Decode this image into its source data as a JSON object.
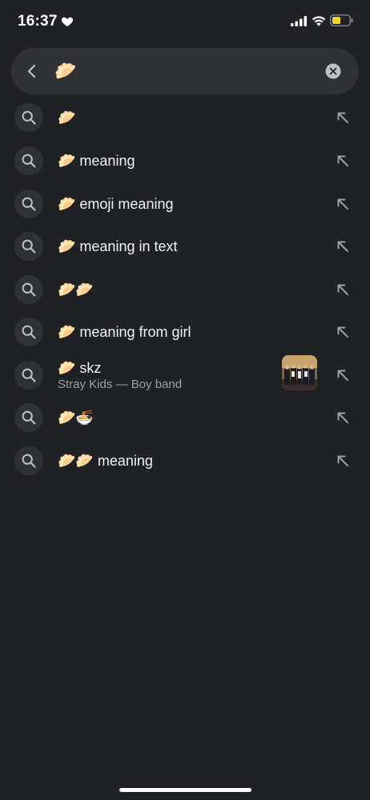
{
  "status_bar": {
    "time": "16:37",
    "heart_icon": "heart-icon",
    "signal_icon": "cellular-signal-icon",
    "wifi_icon": "wifi-icon",
    "battery_icon": "battery-icon",
    "battery_color": "#f2d230",
    "battery_percent": 50
  },
  "search": {
    "query": "🥟",
    "back_icon": "chevron-left-icon",
    "clear_icon": "clear-circle-icon"
  },
  "suggestions": [
    {
      "text": "🥟",
      "sub": ""
    },
    {
      "text": "🥟 meaning",
      "sub": ""
    },
    {
      "text": "🥟 emoji meaning",
      "sub": ""
    },
    {
      "text": "🥟 meaning in text",
      "sub": ""
    },
    {
      "text": "🥟🥟",
      "sub": ""
    },
    {
      "text": "🥟 meaning from girl",
      "sub": ""
    },
    {
      "text": "🥟 skz",
      "sub": "Stray Kids — Boy band",
      "thumbnail": "stray-kids-photo"
    },
    {
      "text": "🥟🍜",
      "sub": ""
    },
    {
      "text": "🥟🥟 meaning",
      "sub": ""
    }
  ],
  "icons": {
    "search": "search-icon",
    "fill_query": "arrow-up-left-icon"
  },
  "colors": {
    "background": "#202124",
    "surface": "#303134",
    "text": "#f1f3f4",
    "subtext": "#9aa0a6",
    "icon": "#9aa0a6"
  }
}
